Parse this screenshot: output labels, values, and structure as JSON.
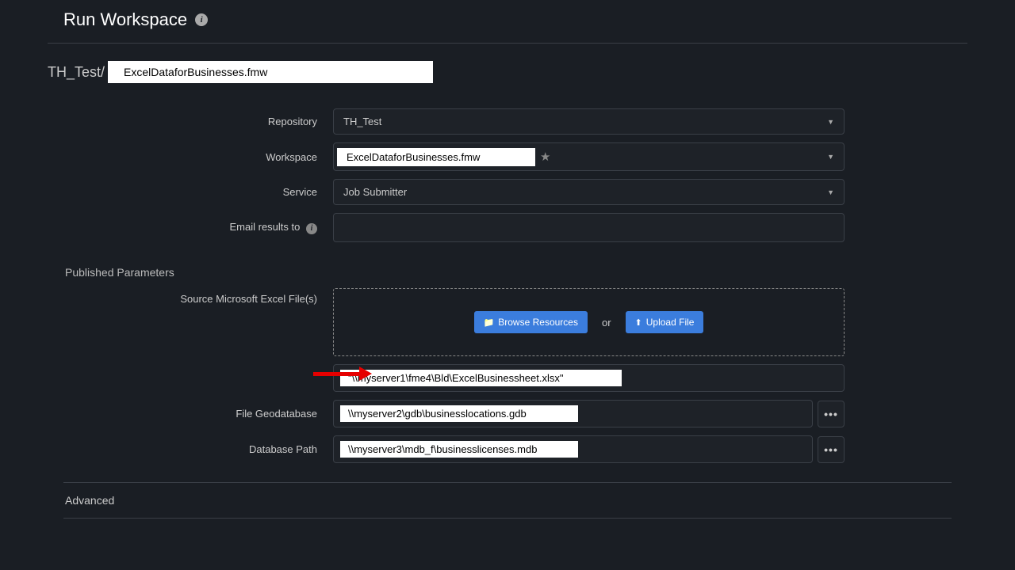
{
  "header": {
    "title": "Run Workspace"
  },
  "breadcrumb": {
    "prefix": "TH_Test/",
    "file": "ExcelDataforBusinesses.fmw"
  },
  "form": {
    "repository": {
      "label": "Repository",
      "value": "TH_Test"
    },
    "workspace": {
      "label": "Workspace",
      "value": "ExcelDataforBusinesses.fmw"
    },
    "service": {
      "label": "Service",
      "value": "Job Submitter"
    },
    "email": {
      "label": "Email results to",
      "value": ""
    }
  },
  "params": {
    "heading": "Published Parameters",
    "source_excel": {
      "label": "Source Microsoft Excel File(s)"
    },
    "browse_button": "Browse Resources",
    "or_text": "or",
    "upload_button": "Upload File",
    "source_path": {
      "value": "\"\\\\myserver1\\fme4\\Bld\\ExcelBusinessheet.xlsx\""
    },
    "file_gdb": {
      "label": "File Geodatabase",
      "value": "\\\\myserver2\\gdb\\businesslocations.gdb"
    },
    "db_path": {
      "label": "Database Path",
      "value": "\\\\myserver3\\mdb_f\\businesslicenses.mdb"
    }
  },
  "advanced": {
    "heading": "Advanced"
  }
}
